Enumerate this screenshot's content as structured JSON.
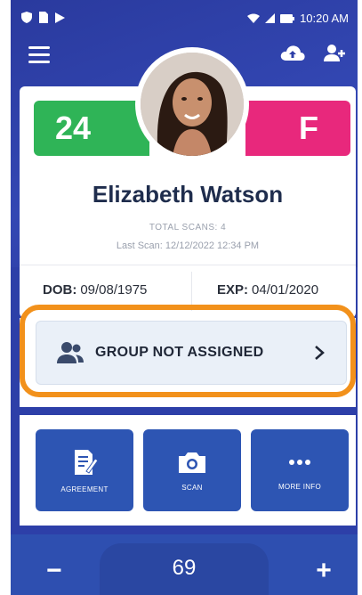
{
  "status_bar": {
    "time": "10:20 AM"
  },
  "icons": {
    "menu": "hamburger-menu-icon",
    "cloud": "cloud-upload-icon",
    "add_user": "person-add-icon",
    "group": "people-icon",
    "chevron": "chevron-right-icon",
    "agreement": "document-sign-icon",
    "scan": "camera-icon",
    "more": "more-dots-icon"
  },
  "profile": {
    "age": "24",
    "sex": "F",
    "name": "Elizabeth Watson",
    "total_scans": "TOTAL SCANS: 4",
    "last_scan": "Last Scan: 12/12/2022 12:34 PM",
    "dob_label": "DOB:",
    "dob_value": "09/08/1975",
    "exp_label": "EXP:",
    "exp_value": "04/01/2020"
  },
  "group": {
    "label": "GROUP NOT ASSIGNED"
  },
  "actions": {
    "agreement": "AGREEMENT",
    "scan": "SCAN",
    "more_info": "MORE INFO"
  },
  "counter": {
    "minus": "−",
    "value": "69",
    "plus": "+"
  },
  "colors": {
    "background": "#2d3fa8",
    "age_badge": "#2fb457",
    "sex_badge": "#e8287c",
    "highlight": "#f2911b",
    "action_button": "#2d55b3"
  }
}
